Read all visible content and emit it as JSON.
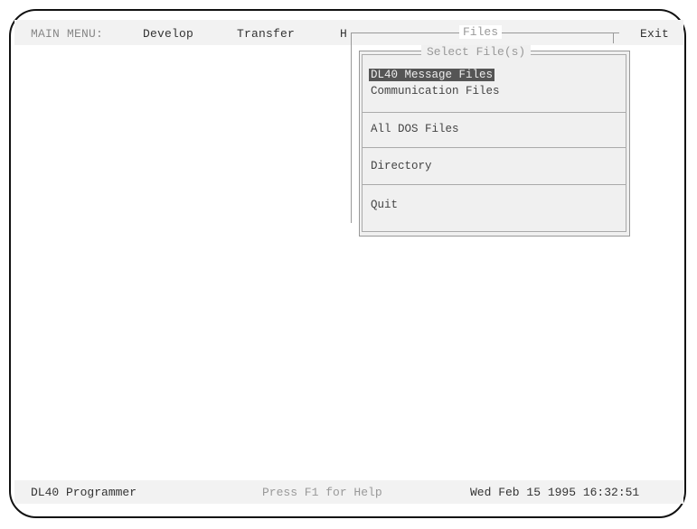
{
  "menubar": {
    "main_menu": "MAIN MENU:",
    "develop": "Develop",
    "transfer": "Transfer",
    "hidden_item": "H",
    "files": "Files",
    "exit": "Exit"
  },
  "dialog": {
    "title": "Select File(s)",
    "options": [
      "DL40 Message Files",
      "Communication Files",
      "All DOS Files",
      "Directory",
      "Quit"
    ],
    "selected_index": 0
  },
  "statusbar": {
    "app": "DL40 Programmer",
    "help": "Press F1 for Help",
    "datetime": "Wed Feb 15 1995 16:32:51"
  }
}
